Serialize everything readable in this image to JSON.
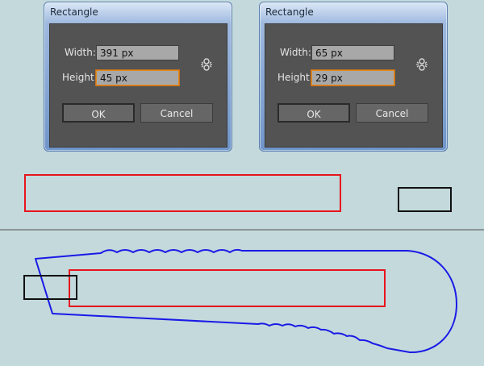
{
  "dialogs": [
    {
      "title": "Rectangle",
      "width_label": "Width:",
      "width_value": "391 px",
      "height_label": "Height:",
      "height_value": "45 px",
      "ok_label": "OK",
      "cancel_label": "Cancel",
      "link_icon": "chain-link-icon"
    },
    {
      "title": "Rectangle",
      "width_label": "Width:",
      "width_value": "65 px",
      "height_label": "Height:",
      "height_value": "29 px",
      "ok_label": "OK",
      "cancel_label": "Cancel",
      "link_icon": "chain-link-icon"
    }
  ],
  "colors": {
    "background": "#c3d9dc",
    "red_shape": "#e8141c",
    "black_shape": "#111111",
    "blue_outline": "#1a1ae6"
  }
}
